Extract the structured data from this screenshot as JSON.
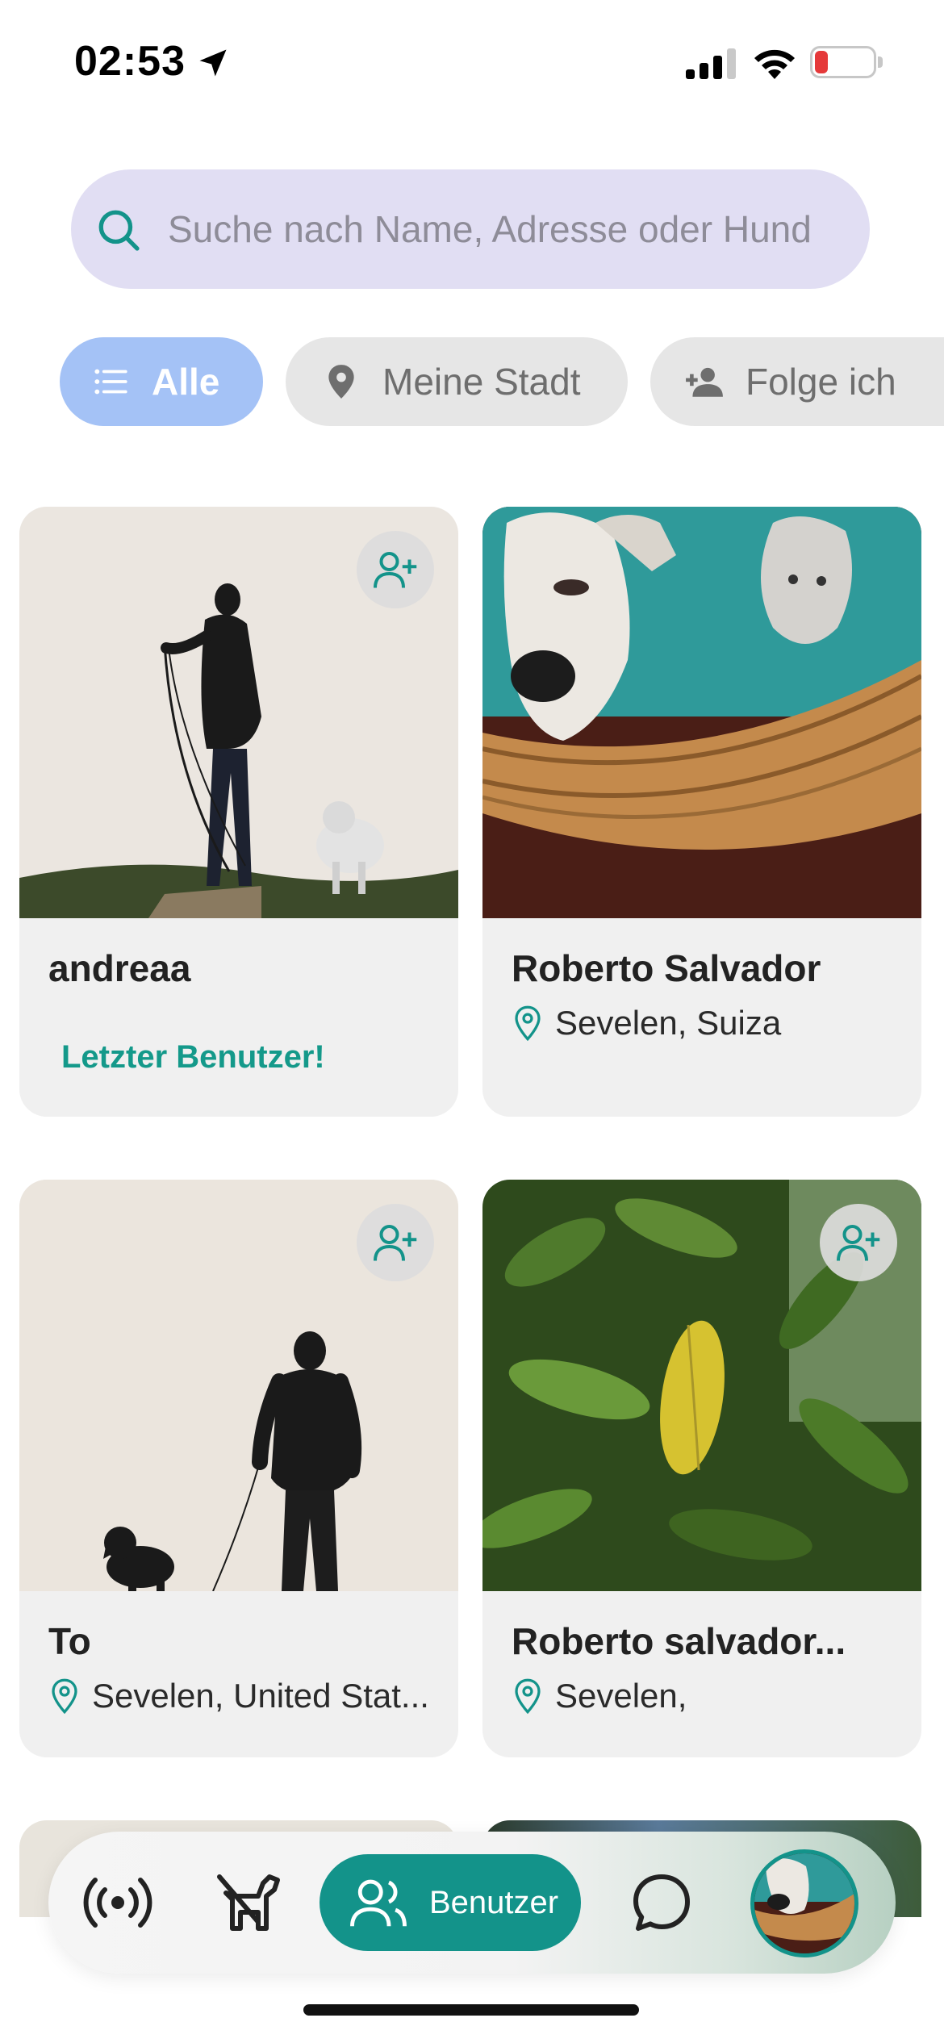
{
  "status_bar": {
    "time": "02:53",
    "battery_level": "15",
    "battery_color": "#e5393a"
  },
  "search": {
    "placeholder": "Suche nach Name, Adresse oder Hund",
    "value": ""
  },
  "filters": [
    {
      "label": "Alle",
      "icon": "list-icon",
      "selected": true
    },
    {
      "label": "Meine Stadt",
      "icon": "location-pin-icon",
      "selected": false
    },
    {
      "label": "Folge ich",
      "icon": "person-add-icon",
      "selected": false
    }
  ],
  "users": [
    {
      "name": "andreaa",
      "location": "",
      "tag": "Letzter Benutzer!",
      "follow_button": true,
      "photo": "woman-walking-dog-silhouette"
    },
    {
      "name": "Roberto Salvador",
      "location": "Sevelen, Suiza",
      "tag": "",
      "follow_button": false,
      "photo": "dog-and-cat-in-basket"
    },
    {
      "name": "To",
      "location": "Sevelen, United Stat...",
      "tag": "",
      "follow_button": true,
      "photo": "man-walking-dog-silhouette"
    },
    {
      "name": "Roberto salvador...",
      "location": "Sevelen,",
      "tag": "",
      "follow_button": true,
      "photo": "green-leaves"
    }
  ],
  "bottom_nav": {
    "items": [
      {
        "name": "live",
        "icon": "broadcast-icon"
      },
      {
        "name": "dogs",
        "icon": "dog-icon"
      },
      {
        "name": "users",
        "icon": "users-icon",
        "label": "Benutzer",
        "active": true
      },
      {
        "name": "chat",
        "icon": "chat-bubble-icon"
      },
      {
        "name": "profile",
        "icon": "avatar"
      }
    ]
  },
  "colors": {
    "accent": "#13938a",
    "search_bg": "#e1def3",
    "chip_active": "#a4c2f6",
    "chip_inactive": "#e6e6e6",
    "card_bg": "#f0f0f0"
  }
}
